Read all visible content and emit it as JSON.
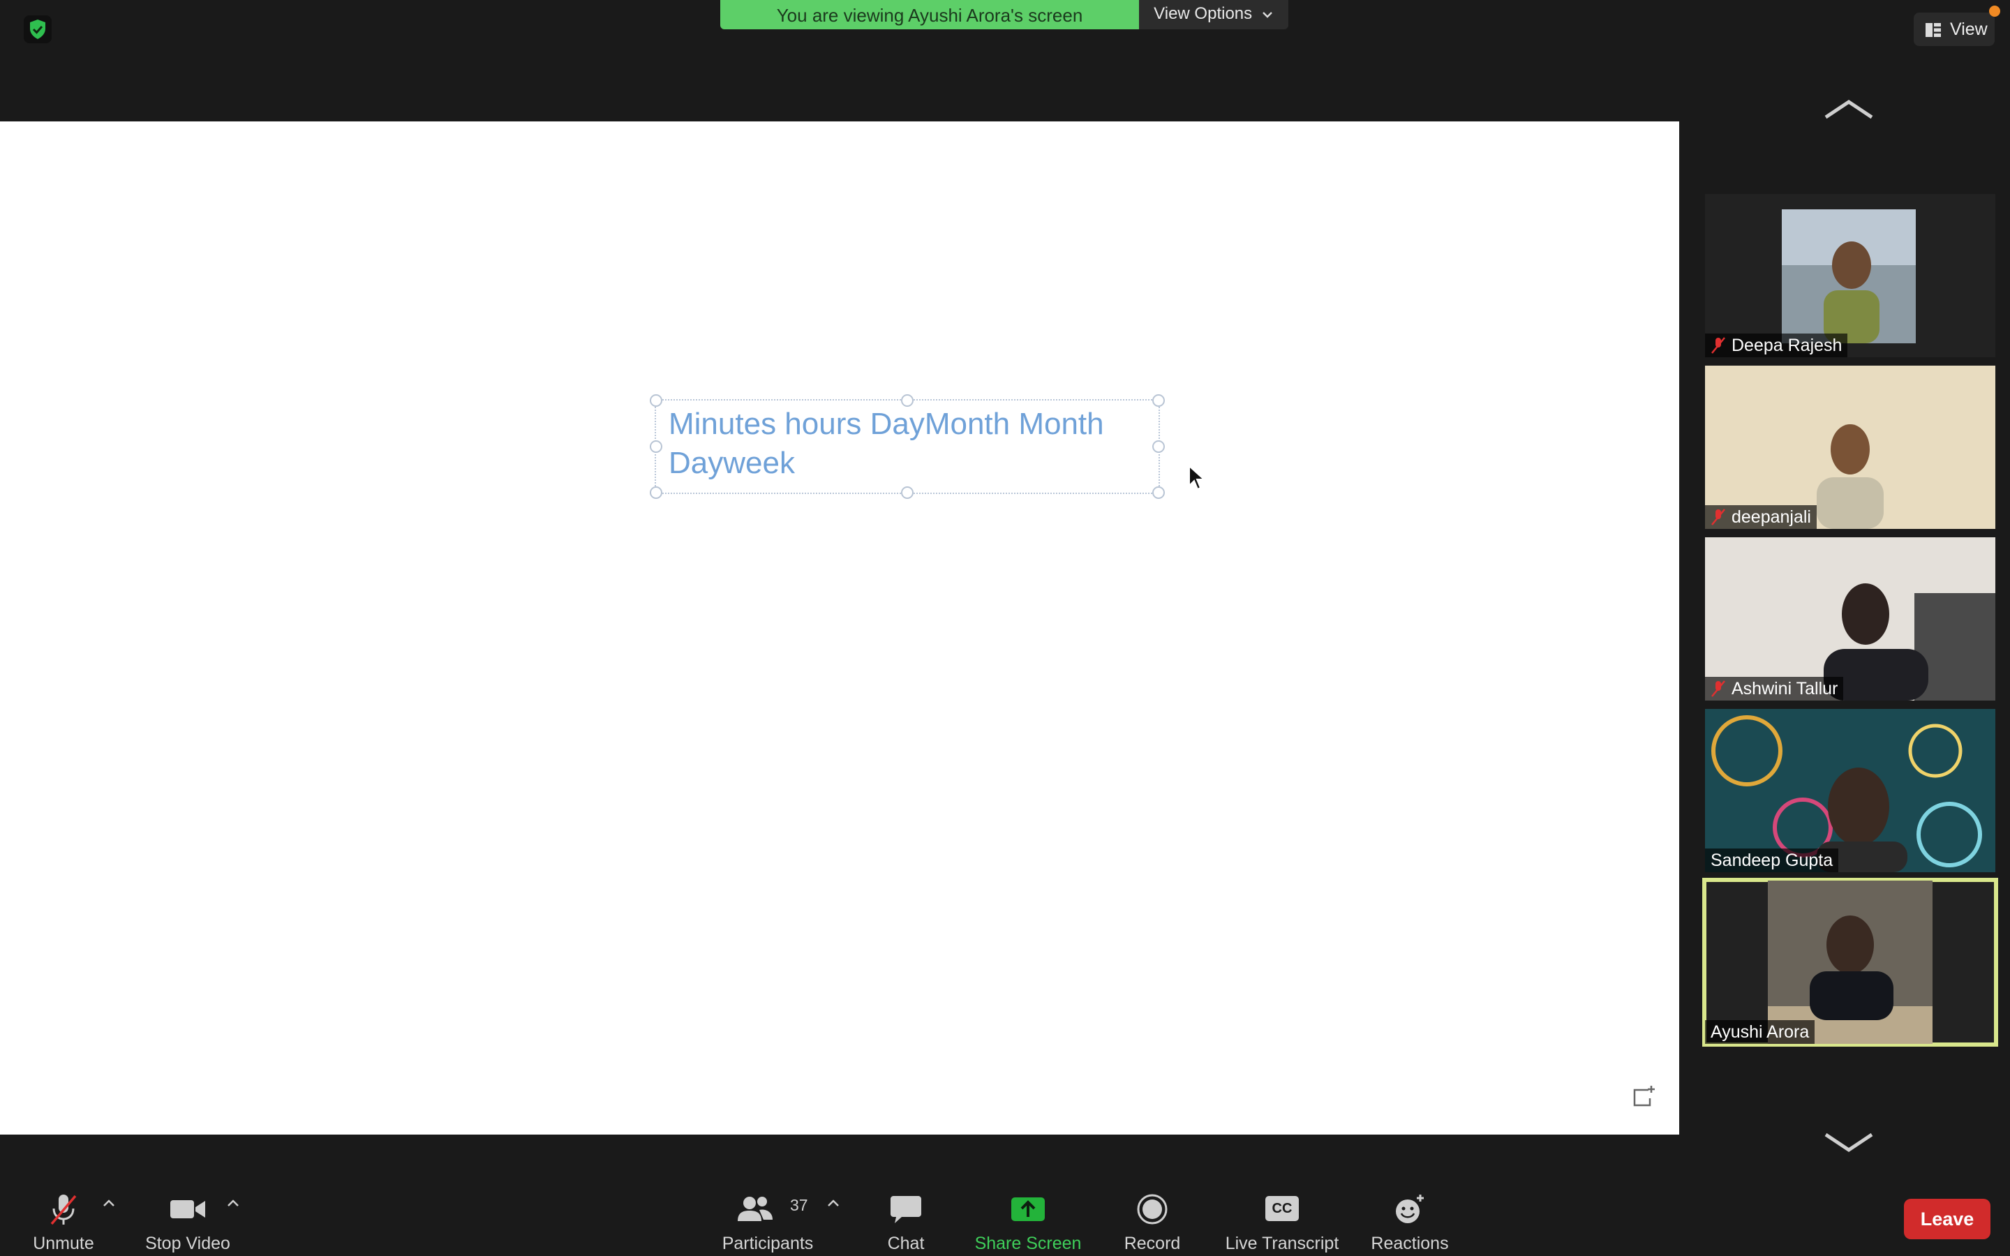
{
  "top": {
    "banner": "You are viewing Ayushi Arora's screen",
    "view_options": "View Options",
    "view_button": "View"
  },
  "shared_screen": {
    "text_line1": "Minutes hours DayMonth Month",
    "text_line2": "Dayweek"
  },
  "participants": [
    {
      "name": "Deepa Rajesh",
      "muted": true
    },
    {
      "name": "deepanjali",
      "muted": true
    },
    {
      "name": "Ashwini Tallur",
      "muted": true
    },
    {
      "name": "Sandeep Gupta",
      "muted": false
    },
    {
      "name": "Ayushi Arora",
      "muted": false,
      "active_speaker": true
    }
  ],
  "toolbar": {
    "unmute": "Unmute",
    "stop_video": "Stop Video",
    "participants": "Participants",
    "participants_count": "37",
    "chat": "Chat",
    "share_screen": "Share Screen",
    "record": "Record",
    "live_transcript": "Live Transcript",
    "transcript_badge": "CC",
    "reactions": "Reactions",
    "leave": "Leave"
  },
  "colors": {
    "banner_green": "#5dcf68",
    "share_green": "#23b33a",
    "leave_red": "#d12b2b",
    "active_outline": "#d9e78c",
    "slide_text_blue": "#6fa1d8"
  }
}
